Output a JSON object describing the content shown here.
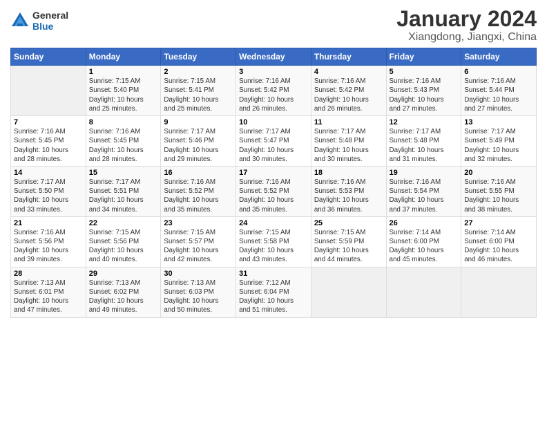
{
  "header": {
    "logo_line1": "General",
    "logo_line2": "Blue",
    "title": "January 2024",
    "subtitle": "Xiangdong, Jiangxi, China"
  },
  "days_of_week": [
    "Sunday",
    "Monday",
    "Tuesday",
    "Wednesday",
    "Thursday",
    "Friday",
    "Saturday"
  ],
  "weeks": [
    [
      {
        "day": "",
        "info": ""
      },
      {
        "day": "1",
        "info": "Sunrise: 7:15 AM\nSunset: 5:40 PM\nDaylight: 10 hours\nand 25 minutes."
      },
      {
        "day": "2",
        "info": "Sunrise: 7:15 AM\nSunset: 5:41 PM\nDaylight: 10 hours\nand 25 minutes."
      },
      {
        "day": "3",
        "info": "Sunrise: 7:16 AM\nSunset: 5:42 PM\nDaylight: 10 hours\nand 26 minutes."
      },
      {
        "day": "4",
        "info": "Sunrise: 7:16 AM\nSunset: 5:42 PM\nDaylight: 10 hours\nand 26 minutes."
      },
      {
        "day": "5",
        "info": "Sunrise: 7:16 AM\nSunset: 5:43 PM\nDaylight: 10 hours\nand 27 minutes."
      },
      {
        "day": "6",
        "info": "Sunrise: 7:16 AM\nSunset: 5:44 PM\nDaylight: 10 hours\nand 27 minutes."
      }
    ],
    [
      {
        "day": "7",
        "info": "Sunrise: 7:16 AM\nSunset: 5:45 PM\nDaylight: 10 hours\nand 28 minutes."
      },
      {
        "day": "8",
        "info": "Sunrise: 7:16 AM\nSunset: 5:45 PM\nDaylight: 10 hours\nand 28 minutes."
      },
      {
        "day": "9",
        "info": "Sunrise: 7:17 AM\nSunset: 5:46 PM\nDaylight: 10 hours\nand 29 minutes."
      },
      {
        "day": "10",
        "info": "Sunrise: 7:17 AM\nSunset: 5:47 PM\nDaylight: 10 hours\nand 30 minutes."
      },
      {
        "day": "11",
        "info": "Sunrise: 7:17 AM\nSunset: 5:48 PM\nDaylight: 10 hours\nand 30 minutes."
      },
      {
        "day": "12",
        "info": "Sunrise: 7:17 AM\nSunset: 5:48 PM\nDaylight: 10 hours\nand 31 minutes."
      },
      {
        "day": "13",
        "info": "Sunrise: 7:17 AM\nSunset: 5:49 PM\nDaylight: 10 hours\nand 32 minutes."
      }
    ],
    [
      {
        "day": "14",
        "info": "Sunrise: 7:17 AM\nSunset: 5:50 PM\nDaylight: 10 hours\nand 33 minutes."
      },
      {
        "day": "15",
        "info": "Sunrise: 7:17 AM\nSunset: 5:51 PM\nDaylight: 10 hours\nand 34 minutes."
      },
      {
        "day": "16",
        "info": "Sunrise: 7:16 AM\nSunset: 5:52 PM\nDaylight: 10 hours\nand 35 minutes."
      },
      {
        "day": "17",
        "info": "Sunrise: 7:16 AM\nSunset: 5:52 PM\nDaylight: 10 hours\nand 35 minutes."
      },
      {
        "day": "18",
        "info": "Sunrise: 7:16 AM\nSunset: 5:53 PM\nDaylight: 10 hours\nand 36 minutes."
      },
      {
        "day": "19",
        "info": "Sunrise: 7:16 AM\nSunset: 5:54 PM\nDaylight: 10 hours\nand 37 minutes."
      },
      {
        "day": "20",
        "info": "Sunrise: 7:16 AM\nSunset: 5:55 PM\nDaylight: 10 hours\nand 38 minutes."
      }
    ],
    [
      {
        "day": "21",
        "info": "Sunrise: 7:16 AM\nSunset: 5:56 PM\nDaylight: 10 hours\nand 39 minutes."
      },
      {
        "day": "22",
        "info": "Sunrise: 7:15 AM\nSunset: 5:56 PM\nDaylight: 10 hours\nand 40 minutes."
      },
      {
        "day": "23",
        "info": "Sunrise: 7:15 AM\nSunset: 5:57 PM\nDaylight: 10 hours\nand 42 minutes."
      },
      {
        "day": "24",
        "info": "Sunrise: 7:15 AM\nSunset: 5:58 PM\nDaylight: 10 hours\nand 43 minutes."
      },
      {
        "day": "25",
        "info": "Sunrise: 7:15 AM\nSunset: 5:59 PM\nDaylight: 10 hours\nand 44 minutes."
      },
      {
        "day": "26",
        "info": "Sunrise: 7:14 AM\nSunset: 6:00 PM\nDaylight: 10 hours\nand 45 minutes."
      },
      {
        "day": "27",
        "info": "Sunrise: 7:14 AM\nSunset: 6:00 PM\nDaylight: 10 hours\nand 46 minutes."
      }
    ],
    [
      {
        "day": "28",
        "info": "Sunrise: 7:13 AM\nSunset: 6:01 PM\nDaylight: 10 hours\nand 47 minutes."
      },
      {
        "day": "29",
        "info": "Sunrise: 7:13 AM\nSunset: 6:02 PM\nDaylight: 10 hours\nand 49 minutes."
      },
      {
        "day": "30",
        "info": "Sunrise: 7:13 AM\nSunset: 6:03 PM\nDaylight: 10 hours\nand 50 minutes."
      },
      {
        "day": "31",
        "info": "Sunrise: 7:12 AM\nSunset: 6:04 PM\nDaylight: 10 hours\nand 51 minutes."
      },
      {
        "day": "",
        "info": ""
      },
      {
        "day": "",
        "info": ""
      },
      {
        "day": "",
        "info": ""
      }
    ]
  ]
}
